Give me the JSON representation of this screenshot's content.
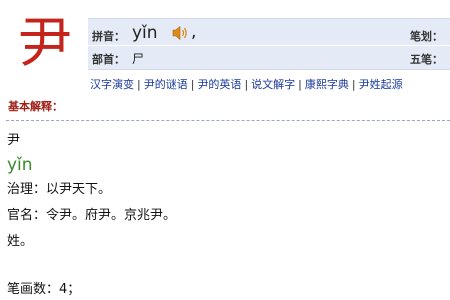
{
  "character": "尹",
  "info": {
    "pinyin_label": "拼音：",
    "pinyin": "yǐn",
    "pinyin_suffix": ",",
    "strokes_label": "笔划：",
    "bushou_label": "部首：",
    "bushou": "尸",
    "wubi_label": "五笔："
  },
  "links": [
    "汉字演变",
    "尹的谜语",
    "尹的英语",
    "说文解字",
    "康熙字典",
    "尹姓起源"
  ],
  "section_title": "基本解释：",
  "definition": {
    "char": "尹",
    "pinyin": "yǐn",
    "lines": [
      "治理：以尹天下。",
      "官名：令尹。府尹。京兆尹。",
      "姓。"
    ],
    "stroke_count": "笔画数：4；"
  },
  "colors": {
    "character": "#c4241b",
    "info_bg": "#e4eaf6",
    "link": "#1a3a9c",
    "section_title": "#a02018",
    "pinyin": "#3a8a2c"
  },
  "icons": {
    "speaker": "speaker-icon"
  }
}
